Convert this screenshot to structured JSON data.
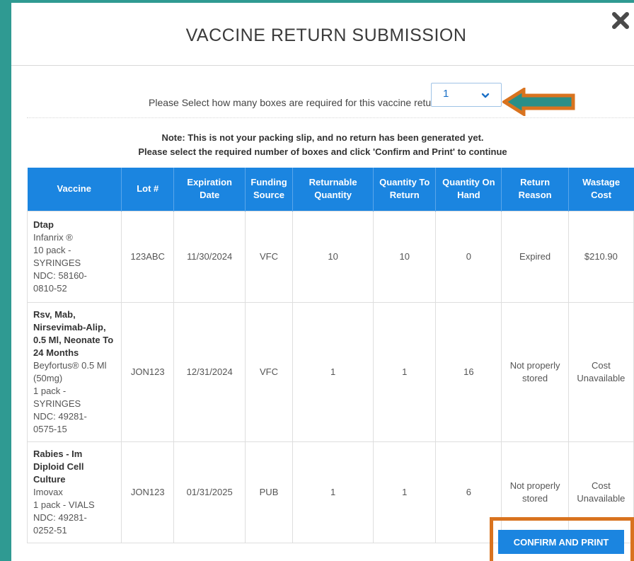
{
  "modal": {
    "title": "VACCINE RETURN SUBMISSION"
  },
  "box_select": {
    "label": "Please Select how many boxes are required for this vaccine return:",
    "value": "1"
  },
  "note": {
    "line1": "Note: This is not your packing slip, and no return has been generated yet.",
    "line2": "Please select the required number of boxes and click 'Confirm and Print' to continue"
  },
  "table": {
    "headers": {
      "vaccine": "Vaccine",
      "lot": "Lot #",
      "expiration": "Expiration Date",
      "funding": "Funding Source",
      "returnable": "Returnable Quantity",
      "qty_return": "Quantity To Return",
      "qty_hand": "Quantity On Hand",
      "reason": "Return Reason",
      "cost": "Wastage Cost"
    },
    "rows": [
      {
        "name": "Dtap",
        "details": [
          "Infanrix ®",
          "10 pack -",
          "SYRINGES",
          "NDC: 58160-",
          "0810-52"
        ],
        "lot": "123ABC",
        "expiration": "11/30/2024",
        "funding": "VFC",
        "returnable": "10",
        "qty_return": "10",
        "qty_hand": "0",
        "reason": "Expired",
        "cost": "$210.90"
      },
      {
        "name": "Rsv, Mab, Nirsevimab-Alip, 0.5 Ml, Neonate To 24 Months",
        "details": [
          "Beyfortus® 0.5 Ml",
          "(50mg)",
          "1 pack - SYRINGES",
          "NDC: 49281-",
          "0575-15"
        ],
        "lot": "JON123",
        "expiration": "12/31/2024",
        "funding": "VFC",
        "returnable": "1",
        "qty_return": "1",
        "qty_hand": "16",
        "reason": "Not properly stored",
        "cost": "Cost Unavailable"
      },
      {
        "name": "Rabies - Im Diploid Cell Culture",
        "details": [
          "Imovax",
          "1 pack - VIALS",
          "NDC: 49281-",
          "0252-51"
        ],
        "lot": "JON123",
        "expiration": "01/31/2025",
        "funding": "PUB",
        "returnable": "1",
        "qty_return": "1",
        "qty_hand": "6",
        "reason": "Not properly stored",
        "cost": "Cost Unavailable"
      }
    ]
  },
  "confirm_button": {
    "label": "CONFIRM AND PRINT"
  },
  "icons": {
    "close": "close-icon",
    "dropdown": "chevron-down-icon",
    "annotation": "arrow-left-icon"
  },
  "colors": {
    "background": "#2f9a92",
    "header_blue": "#1b85e0",
    "annotation_orange": "#d9731f",
    "arrow_teal": "#2a8f88"
  }
}
